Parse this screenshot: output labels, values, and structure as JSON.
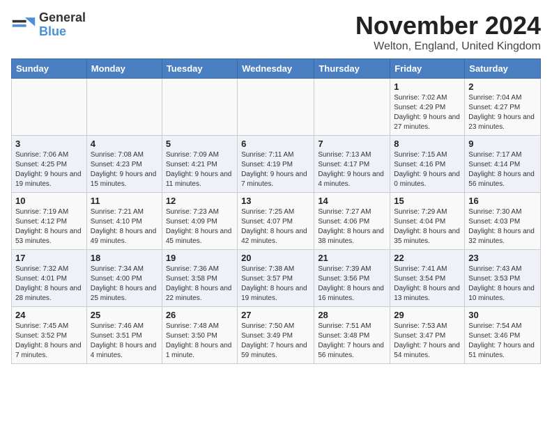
{
  "logo": {
    "text_general": "General",
    "text_blue": "Blue"
  },
  "header": {
    "month_year": "November 2024",
    "location": "Welton, England, United Kingdom"
  },
  "weekdays": [
    "Sunday",
    "Monday",
    "Tuesday",
    "Wednesday",
    "Thursday",
    "Friday",
    "Saturday"
  ],
  "weeks": [
    [
      {
        "day": "",
        "info": ""
      },
      {
        "day": "",
        "info": ""
      },
      {
        "day": "",
        "info": ""
      },
      {
        "day": "",
        "info": ""
      },
      {
        "day": "",
        "info": ""
      },
      {
        "day": "1",
        "info": "Sunrise: 7:02 AM\nSunset: 4:29 PM\nDaylight: 9 hours and 27 minutes."
      },
      {
        "day": "2",
        "info": "Sunrise: 7:04 AM\nSunset: 4:27 PM\nDaylight: 9 hours and 23 minutes."
      }
    ],
    [
      {
        "day": "3",
        "info": "Sunrise: 7:06 AM\nSunset: 4:25 PM\nDaylight: 9 hours and 19 minutes."
      },
      {
        "day": "4",
        "info": "Sunrise: 7:08 AM\nSunset: 4:23 PM\nDaylight: 9 hours and 15 minutes."
      },
      {
        "day": "5",
        "info": "Sunrise: 7:09 AM\nSunset: 4:21 PM\nDaylight: 9 hours and 11 minutes."
      },
      {
        "day": "6",
        "info": "Sunrise: 7:11 AM\nSunset: 4:19 PM\nDaylight: 9 hours and 7 minutes."
      },
      {
        "day": "7",
        "info": "Sunrise: 7:13 AM\nSunset: 4:17 PM\nDaylight: 9 hours and 4 minutes."
      },
      {
        "day": "8",
        "info": "Sunrise: 7:15 AM\nSunset: 4:16 PM\nDaylight: 9 hours and 0 minutes."
      },
      {
        "day": "9",
        "info": "Sunrise: 7:17 AM\nSunset: 4:14 PM\nDaylight: 8 hours and 56 minutes."
      }
    ],
    [
      {
        "day": "10",
        "info": "Sunrise: 7:19 AM\nSunset: 4:12 PM\nDaylight: 8 hours and 53 minutes."
      },
      {
        "day": "11",
        "info": "Sunrise: 7:21 AM\nSunset: 4:10 PM\nDaylight: 8 hours and 49 minutes."
      },
      {
        "day": "12",
        "info": "Sunrise: 7:23 AM\nSunset: 4:09 PM\nDaylight: 8 hours and 45 minutes."
      },
      {
        "day": "13",
        "info": "Sunrise: 7:25 AM\nSunset: 4:07 PM\nDaylight: 8 hours and 42 minutes."
      },
      {
        "day": "14",
        "info": "Sunrise: 7:27 AM\nSunset: 4:06 PM\nDaylight: 8 hours and 38 minutes."
      },
      {
        "day": "15",
        "info": "Sunrise: 7:29 AM\nSunset: 4:04 PM\nDaylight: 8 hours and 35 minutes."
      },
      {
        "day": "16",
        "info": "Sunrise: 7:30 AM\nSunset: 4:03 PM\nDaylight: 8 hours and 32 minutes."
      }
    ],
    [
      {
        "day": "17",
        "info": "Sunrise: 7:32 AM\nSunset: 4:01 PM\nDaylight: 8 hours and 28 minutes."
      },
      {
        "day": "18",
        "info": "Sunrise: 7:34 AM\nSunset: 4:00 PM\nDaylight: 8 hours and 25 minutes."
      },
      {
        "day": "19",
        "info": "Sunrise: 7:36 AM\nSunset: 3:58 PM\nDaylight: 8 hours and 22 minutes."
      },
      {
        "day": "20",
        "info": "Sunrise: 7:38 AM\nSunset: 3:57 PM\nDaylight: 8 hours and 19 minutes."
      },
      {
        "day": "21",
        "info": "Sunrise: 7:39 AM\nSunset: 3:56 PM\nDaylight: 8 hours and 16 minutes."
      },
      {
        "day": "22",
        "info": "Sunrise: 7:41 AM\nSunset: 3:54 PM\nDaylight: 8 hours and 13 minutes."
      },
      {
        "day": "23",
        "info": "Sunrise: 7:43 AM\nSunset: 3:53 PM\nDaylight: 8 hours and 10 minutes."
      }
    ],
    [
      {
        "day": "24",
        "info": "Sunrise: 7:45 AM\nSunset: 3:52 PM\nDaylight: 8 hours and 7 minutes."
      },
      {
        "day": "25",
        "info": "Sunrise: 7:46 AM\nSunset: 3:51 PM\nDaylight: 8 hours and 4 minutes."
      },
      {
        "day": "26",
        "info": "Sunrise: 7:48 AM\nSunset: 3:50 PM\nDaylight: 8 hours and 1 minute."
      },
      {
        "day": "27",
        "info": "Sunrise: 7:50 AM\nSunset: 3:49 PM\nDaylight: 7 hours and 59 minutes."
      },
      {
        "day": "28",
        "info": "Sunrise: 7:51 AM\nSunset: 3:48 PM\nDaylight: 7 hours and 56 minutes."
      },
      {
        "day": "29",
        "info": "Sunrise: 7:53 AM\nSunset: 3:47 PM\nDaylight: 7 hours and 54 minutes."
      },
      {
        "day": "30",
        "info": "Sunrise: 7:54 AM\nSunset: 3:46 PM\nDaylight: 7 hours and 51 minutes."
      }
    ]
  ]
}
